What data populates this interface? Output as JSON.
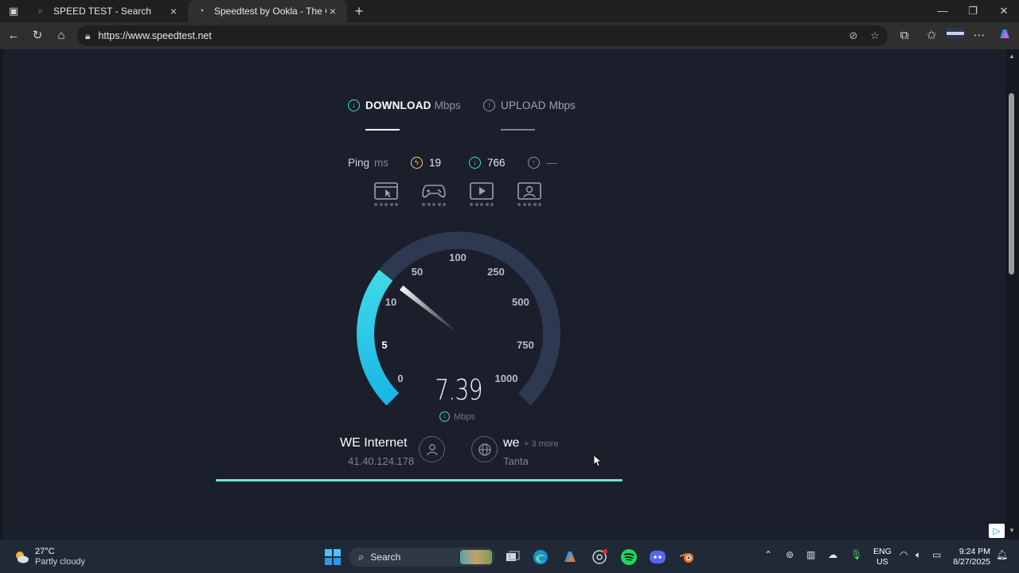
{
  "browser": {
    "tabs": [
      {
        "title": "SPEED TEST - Search",
        "active": false
      },
      {
        "title": "Speedtest by Ookla - The Global Broadband Speed Test",
        "active": true
      }
    ],
    "url": "https://www.speedtest.net"
  },
  "header": {
    "download_label": "DOWNLOAD",
    "download_unit": "Mbps",
    "upload_label": "UPLOAD",
    "upload_unit": "Mbps"
  },
  "ping": {
    "label": "Ping",
    "unit": "ms",
    "idle": "19",
    "download": "766",
    "upload": "—"
  },
  "gauge": {
    "ticks": [
      "0",
      "5",
      "10",
      "50",
      "100",
      "250",
      "500",
      "750",
      "1000"
    ],
    "value": "7.39",
    "unit": "Mbps",
    "fill_fraction": 0.31
  },
  "isp": {
    "name": "WE Internet",
    "ip": "41.40.124.178"
  },
  "server": {
    "name": "we",
    "more": "+ 3 more",
    "location": "Tanta"
  },
  "taskbar": {
    "weather_temp": "27°C",
    "weather_desc": "Partly cloudy",
    "search_label": "Search",
    "lang_top": "ENG",
    "lang_bottom": "US",
    "time": "9:24 PM",
    "date": "8/27/2025"
  },
  "colors": {
    "accent": "#3ee0c4",
    "gauge_fill": "#1fc5e0",
    "background": "#1b1e2b"
  }
}
